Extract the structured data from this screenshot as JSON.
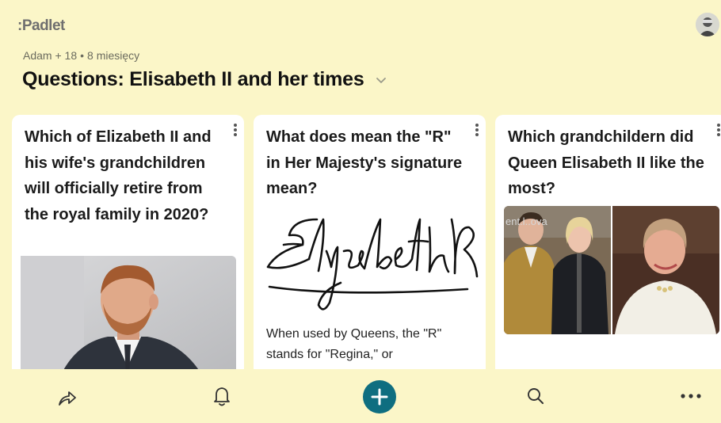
{
  "app": {
    "logo_text": ":Padlet"
  },
  "header": {
    "author": "Adam + 18",
    "separator": "•",
    "time_ago": "8 miesięcy",
    "title": "Questions: Elisabeth II and her times"
  },
  "cards": [
    {
      "title": "Which of Elizabeth II and his wife's grandchildren will officially retire from the royal family in 2020?",
      "image_icon": "person-photo-prince-harry"
    },
    {
      "title": "What does mean the \"R\" in Her Majesty's signature mean?",
      "image_icon": "signature-elizabeth-r",
      "body": "When used by Queens, the \"R\" stands for \"Regina,\" or"
    },
    {
      "title": "Which grandchildern did Queen Elisabeth II like the most?",
      "image_icon": "photo-collage-royal-family",
      "image_text": "ent.l..ova"
    }
  ],
  "bottom_nav": {
    "share_icon": "share-icon",
    "notifications_icon": "bell-icon",
    "add_icon": "plus-icon",
    "search_icon": "search-icon",
    "more_icon": "more-horizontal-icon"
  },
  "colors": {
    "background": "#fbf6c8",
    "card": "#ffffff",
    "accent": "#0f6e80"
  }
}
